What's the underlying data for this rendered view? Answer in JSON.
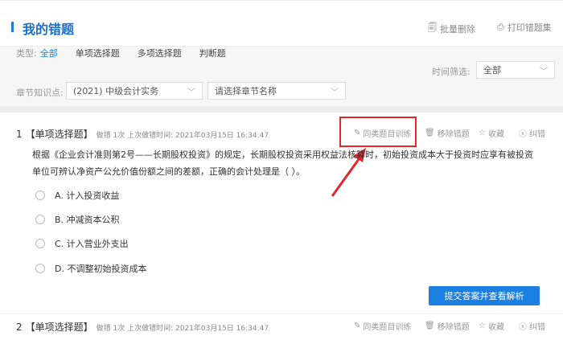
{
  "header": {
    "title": "我的错题",
    "batch_delete": "批量删除",
    "print": "打印错题集"
  },
  "filters": {
    "type_label": "类型:",
    "types": [
      "全部",
      "单项选择题",
      "多项选择题",
      "判断题"
    ],
    "time_label": "时间筛选:",
    "time_value": "全部",
    "chapter_label": "章节知识点:",
    "subject_value": "(2021) 中级会计实务",
    "chapter_placeholder": "请选择章节名称"
  },
  "actions": {
    "similar": "同类题目训练",
    "remove": "移除错题",
    "favorite": "收藏",
    "correct": "纠错"
  },
  "questions": [
    {
      "num": "1",
      "type": "【单项选择题】",
      "meta": "做错 1次 上次做错时间: 2021年03月15日 16:34:47",
      "text": "根据《企业会计准则第2号——长期股权投资》的规定，长期股权投资采用权益法核算时，初始投资成本大于投资时应享有被投资单位可辨认净资产公允价值份额之间的差额，正确的会计处理是（  ）。",
      "options": [
        "A. 计入投资收益",
        "B. 冲减资本公积",
        "C. 计入营业外支出",
        "D. 不调整初始投资成本"
      ],
      "submit": "提交答案并查看解析"
    },
    {
      "num": "2",
      "type": "【单项选择题】",
      "meta": "做错 1次 上次做错时间: 2021年03月15日 16:34:47"
    }
  ],
  "colors": {
    "accent": "#1a7fe0",
    "highlight": "#e8262a"
  }
}
